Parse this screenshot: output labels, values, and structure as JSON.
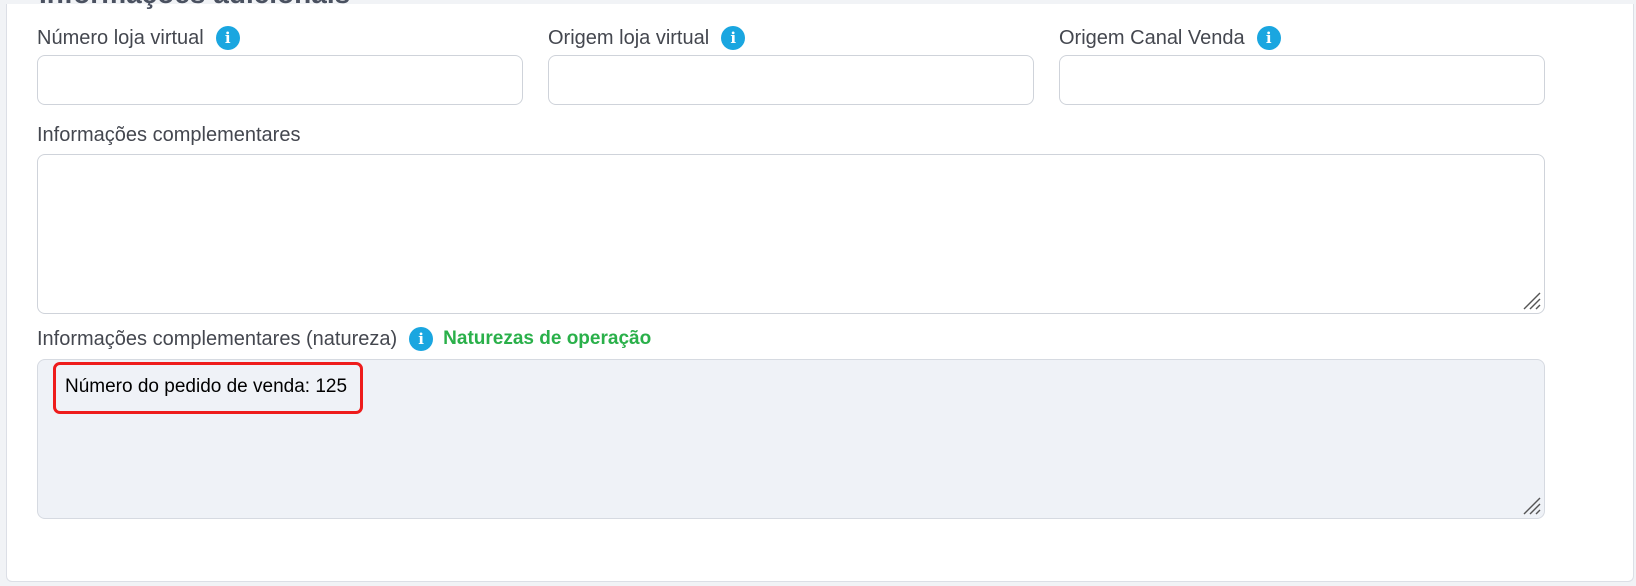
{
  "section": {
    "title": "Informações adicionais"
  },
  "fields": {
    "numero_loja": {
      "label": "Número loja virtual",
      "value": ""
    },
    "origem_loja": {
      "label": "Origem loja virtual",
      "value": ""
    },
    "origem_canal": {
      "label": "Origem Canal Venda",
      "value": ""
    }
  },
  "info_complementares": {
    "label": "Informações complementares",
    "value": ""
  },
  "info_natureza": {
    "label": "Informações complementares (natureza)",
    "link_label": "Naturezas de operação",
    "value": "Número do pedido de venda: 125"
  },
  "icons": {
    "info": "info-icon",
    "resize": "resize-grip-icon"
  },
  "colors": {
    "info_icon": "#1aa6e0",
    "link_green": "#2ab04a",
    "highlight": "#ee1c1c",
    "readonly_bg": "#eff2f7"
  }
}
